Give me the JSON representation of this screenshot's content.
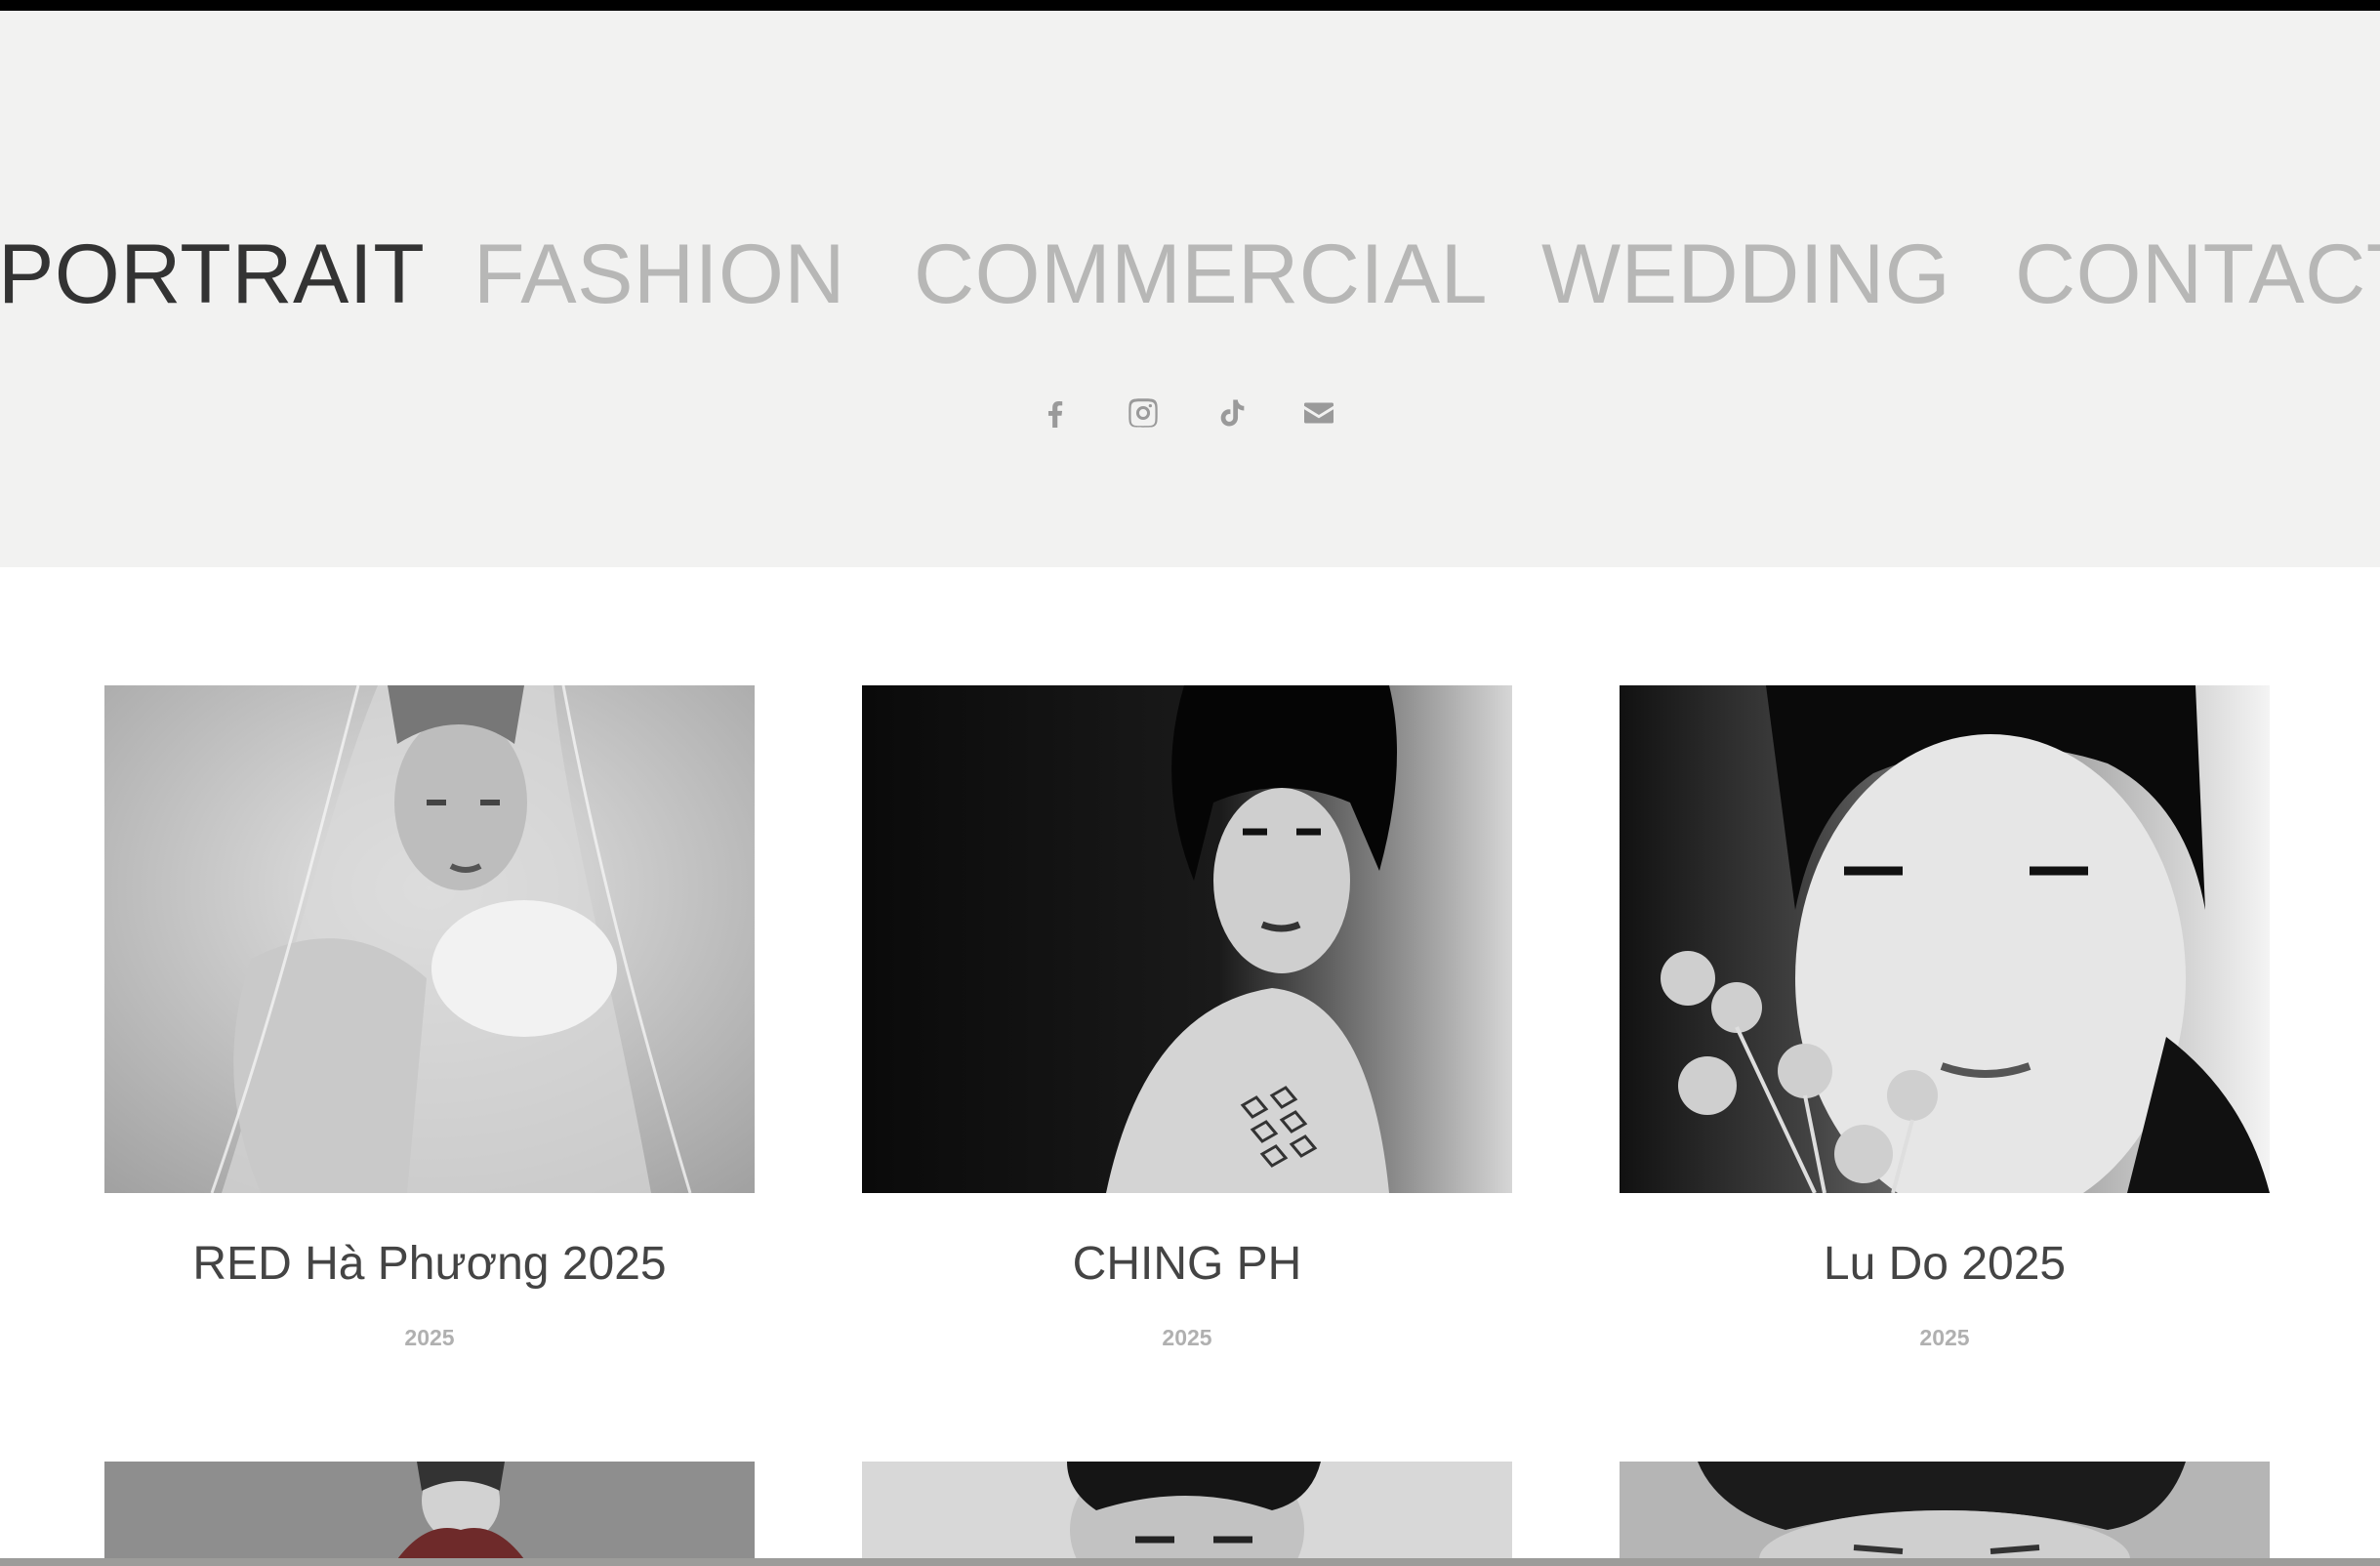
{
  "nav": {
    "items": [
      {
        "label": "PORTRAIT",
        "active": true
      },
      {
        "label": "FASHION",
        "active": false
      },
      {
        "label": "COMMERCIAL",
        "active": false
      },
      {
        "label": "WEDDING",
        "active": false
      },
      {
        "label": "CONTACT",
        "active": false
      }
    ]
  },
  "social": {
    "icons": [
      "facebook-icon",
      "instagram-icon",
      "tiktok-icon",
      "mail-icon"
    ]
  },
  "gallery": {
    "items": [
      {
        "title": "RED Hà Phương 2025",
        "year": "2025",
        "image": "bw-portrait-veil"
      },
      {
        "title": "CHING PH",
        "year": "2025",
        "image": "bw-portrait-bob-hair"
      },
      {
        "title": "Lu Do 2025",
        "year": "2025",
        "image": "bw-portrait-flowers"
      }
    ],
    "next_row_images": [
      "bw-portrait-bride",
      "bw-portrait-man",
      "bw-portrait-man-looking-down"
    ]
  },
  "colors": {
    "header_bg": "#f2f2f1",
    "nav_active": "#333333",
    "nav_inactive": "#b7b7b6",
    "icon": "#9a9a9a",
    "title": "#444444",
    "year": "#b0b0b0"
  }
}
